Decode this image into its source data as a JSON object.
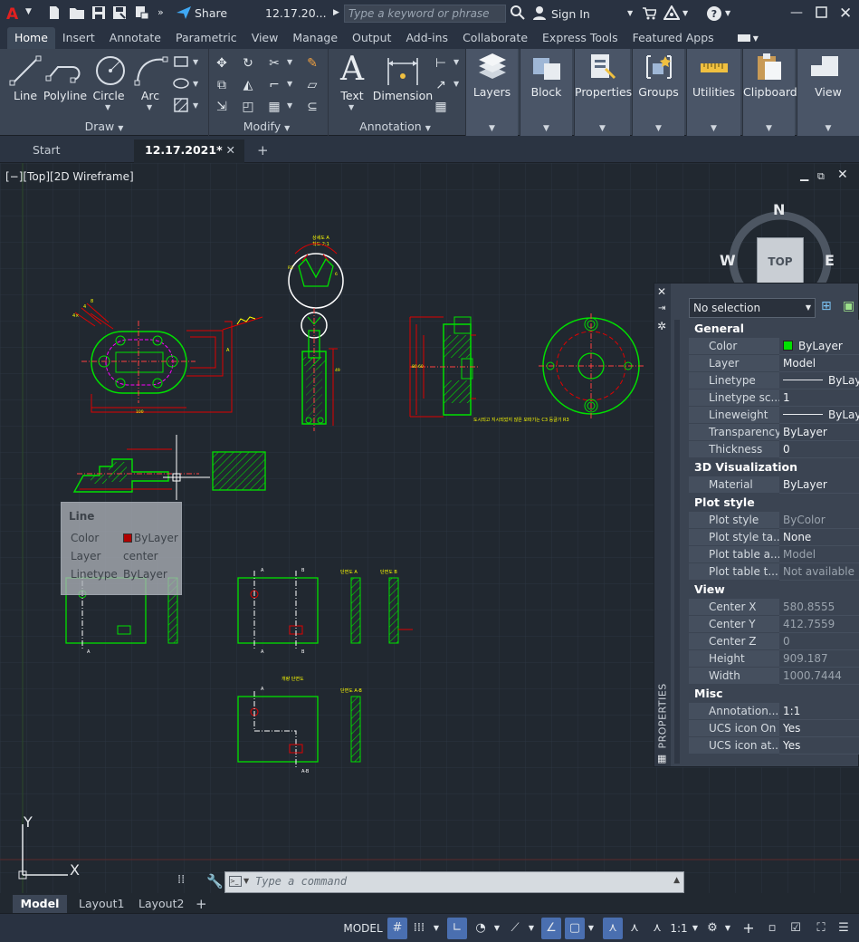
{
  "titlebar": {
    "filename": "12.17.20...",
    "share_label": "Share",
    "search_placeholder": "Type a keyword or phrase",
    "signin_label": "Sign In"
  },
  "ribbon_tabs": [
    "Home",
    "Insert",
    "Annotate",
    "Parametric",
    "View",
    "Manage",
    "Output",
    "Add-ins",
    "Collaborate",
    "Express Tools",
    "Featured Apps"
  ],
  "ribbon": {
    "draw": {
      "title": "Draw",
      "line": "Line",
      "polyline": "Polyline",
      "circle": "Circle",
      "arc": "Arc"
    },
    "modify": {
      "title": "Modify"
    },
    "annotation": {
      "title": "Annotation",
      "text": "Text",
      "dimension": "Dimension"
    },
    "panels": [
      "Layers",
      "Block",
      "Properties",
      "Groups",
      "Utilities",
      "Clipboard",
      "View"
    ]
  },
  "doc_tabs": {
    "start": "Start",
    "current": "12.17.2021*"
  },
  "viewport": {
    "label": "[−][Top][2D Wireframe]"
  },
  "viewcube": {
    "north": "N",
    "south": "S",
    "west": "W",
    "east": "E",
    "top": "TOP"
  },
  "tooltip": {
    "title": "Line",
    "rows": [
      {
        "key": "Color",
        "value": "ByLayer"
      },
      {
        "key": "Layer",
        "value": "center"
      },
      {
        "key": "Linetype",
        "value": "ByLayer"
      }
    ]
  },
  "drawing_text": {
    "detail_a_title": "상세도 A",
    "detail_a_scale": "척도 2:1",
    "korean_note": "도시되고 지시되었지 않은 모따기는 C3 둥글기 R3",
    "view_label": "개량 단면도",
    "section_a": "단면도 A",
    "section_b": "단면도 B",
    "section_ab": "단면도 A-B",
    "cut_a": "A",
    "cut_b": "B",
    "cut_ab": "A-B"
  },
  "properties": {
    "selection": "No selection",
    "side_label": "PROPERTIES",
    "sections": [
      {
        "name": "General",
        "rows": [
          {
            "k": "Color",
            "v": "ByLayer",
            "swatch": "#00e000"
          },
          {
            "k": "Layer",
            "v": "Model"
          },
          {
            "k": "Linetype",
            "v": "ByLayer",
            "line": true
          },
          {
            "k": "Linetype sc...",
            "v": "1"
          },
          {
            "k": "Lineweight",
            "v": "ByLayer",
            "line": true
          },
          {
            "k": "Transparency",
            "v": "ByLayer"
          },
          {
            "k": "Thickness",
            "v": "0"
          }
        ]
      },
      {
        "name": "3D Visualization",
        "rows": [
          {
            "k": "Material",
            "v": "ByLayer"
          }
        ]
      },
      {
        "name": "Plot style",
        "rows": [
          {
            "k": "Plot style",
            "v": "ByColor",
            "dim": true
          },
          {
            "k": "Plot style ta...",
            "v": "None"
          },
          {
            "k": "Plot table a...",
            "v": "Model",
            "dim": true
          },
          {
            "k": "Plot table t...",
            "v": "Not available",
            "dim": true
          }
        ]
      },
      {
        "name": "View",
        "rows": [
          {
            "k": "Center X",
            "v": "580.8555",
            "dim": true
          },
          {
            "k": "Center Y",
            "v": "412.7559",
            "dim": true
          },
          {
            "k": "Center Z",
            "v": "0",
            "dim": true
          },
          {
            "k": "Height",
            "v": "909.187",
            "dim": true
          },
          {
            "k": "Width",
            "v": "1000.7444",
            "dim": true
          }
        ]
      },
      {
        "name": "Misc",
        "rows": [
          {
            "k": "Annotation...",
            "v": "1:1"
          },
          {
            "k": "UCS icon On",
            "v": "Yes"
          },
          {
            "k": "UCS icon at...",
            "v": "Yes"
          }
        ]
      }
    ]
  },
  "ucs": {
    "x": "X",
    "y": "Y"
  },
  "command": {
    "placeholder": "Type a command"
  },
  "layout_tabs": [
    "Model",
    "Layout1",
    "Layout2"
  ],
  "status": {
    "model": "MODEL",
    "scale": "1:1"
  },
  "colors": {
    "accent": "#4a6fb0",
    "green": "#00e000",
    "red": "#e00000",
    "yellow": "#ffff00",
    "magenta": "#ff00ff"
  }
}
